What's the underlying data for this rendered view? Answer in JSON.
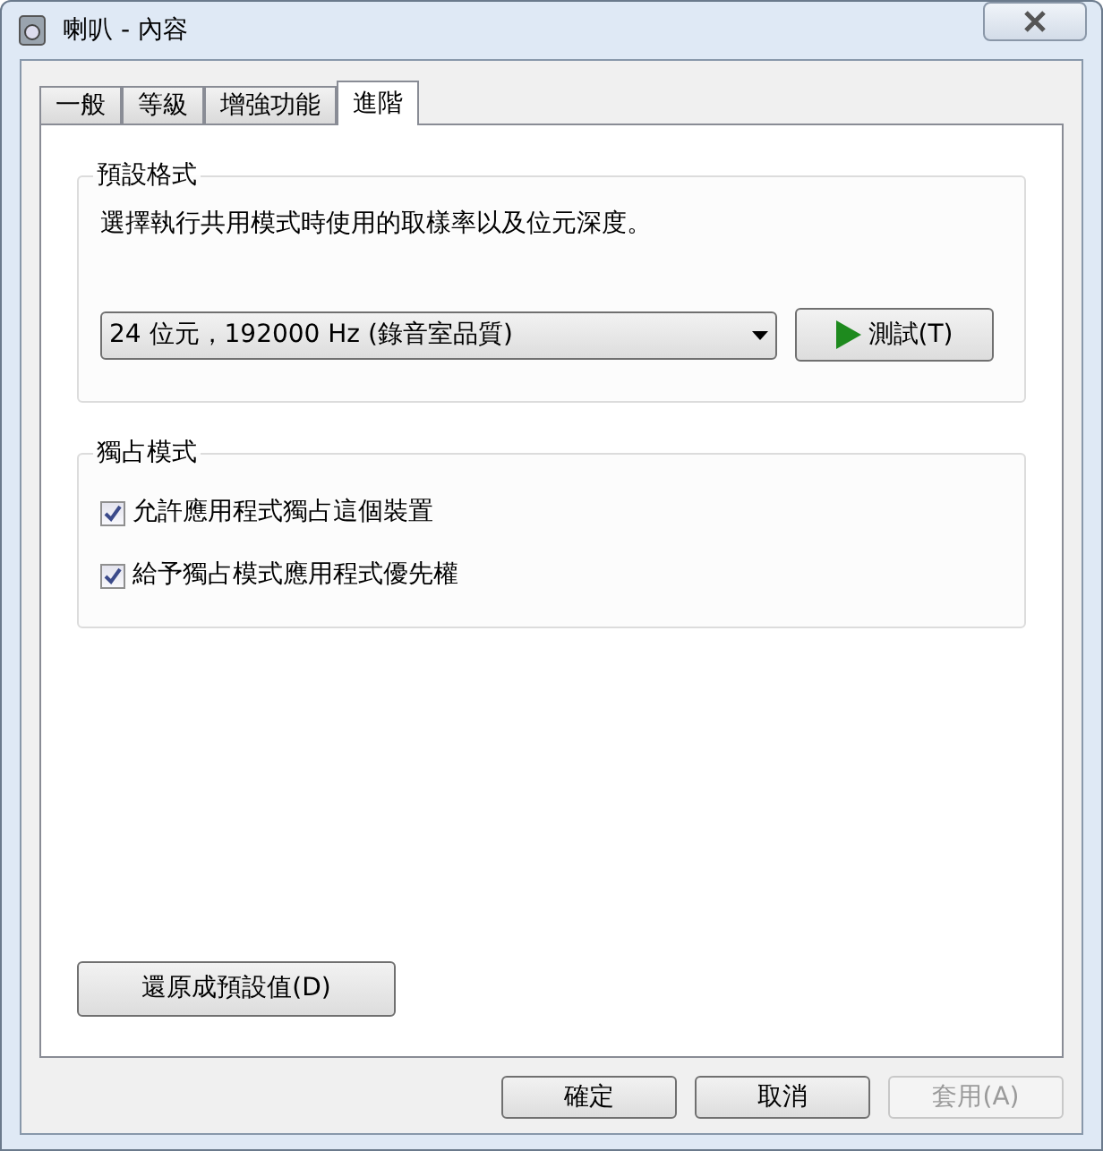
{
  "window": {
    "title": "喇叭 - 內容"
  },
  "tabs": [
    {
      "label": "一般",
      "selected": false
    },
    {
      "label": "等級",
      "selected": false
    },
    {
      "label": "增強功能",
      "selected": false
    },
    {
      "label": "進階",
      "selected": true
    }
  ],
  "default_format": {
    "title": "預設格式",
    "description": "選擇執行共用模式時使用的取樣率以及位元深度。",
    "format_value": "24 位元，192000 Hz (錄音室品質)",
    "test_button": "測試(T)"
  },
  "exclusive_mode": {
    "title": "獨占模式",
    "options": [
      {
        "label": "允許應用程式獨占這個裝置",
        "checked": true
      },
      {
        "label": "給予獨占模式應用程式優先權",
        "checked": true
      }
    ]
  },
  "restore_button": "還原成預設值(D)",
  "buttons": [
    {
      "label": "確定",
      "disabled": false
    },
    {
      "label": "取消",
      "disabled": false
    },
    {
      "label": "套用(A)",
      "disabled": true
    }
  ]
}
